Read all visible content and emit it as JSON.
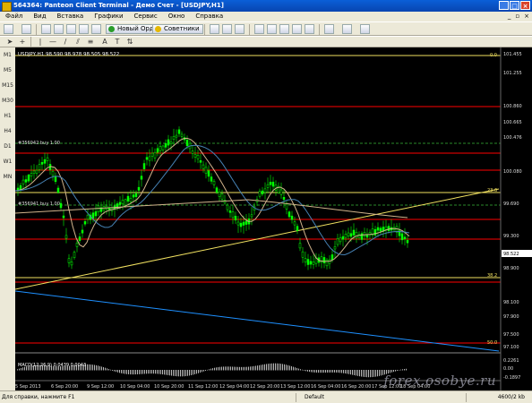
{
  "window": {
    "title": "564364: Panteon Client Terminal - Демо Счет - [USDJPY,H1]"
  },
  "menu": {
    "items": [
      "Файл",
      "Вид",
      "Вставка",
      "Графики",
      "Сервис",
      "Окно",
      "Справка"
    ]
  },
  "toolbar": {
    "new_order_label": "Новый Ордер",
    "advisors_label": "Советники"
  },
  "periods": [
    "M1",
    "M5",
    "M15",
    "M30",
    "H1",
    "H4",
    "D1",
    "W1",
    "MN"
  ],
  "chart": {
    "symbol_label": "USDJPY,H1  98.590 98.978 98.505 98.522",
    "order_labels": [
      "#356942 buy 1.00",
      "#356941 buy 1.00"
    ],
    "price_axis": [
      "101.455",
      "101.255",
      "100.860",
      "100.665",
      "100.476",
      "100.080",
      "99.690",
      "99.300",
      "98.900",
      "98.522",
      "98.100",
      "97.900",
      "97.500",
      "97.100"
    ],
    "level_tags": {
      "top": "0.0",
      "mid": "23.6",
      "low": "38.2",
      "bottom": "50.0"
    },
    "time_axis": [
      "5 Sep 2013",
      "6 Sep 20:00",
      "9 Sep 12:00",
      "10 Sep 04:00",
      "10 Sep 20:00",
      "11 Sep 12:00",
      "12 Sep 04:00",
      "12 Sep 20:00",
      "13 Sep 12:00",
      "16 Sep 04:00",
      "16 Sep 20:00",
      "17 Sep 12:00",
      "18 Sep 04:00"
    ],
    "macd_label": "MACD(12,26,9)  0.0439 0.0043",
    "macd_axis": [
      "0.2261",
      "0.00",
      "-0.1897"
    ],
    "watermark": "forex.osobye.ru",
    "colors": {
      "bull": "#00ff00",
      "bear": "#00ff00",
      "red_line": "#ff0000",
      "trend": "#f0e060",
      "blue": "#1e90ff"
    }
  },
  "status": {
    "help": "Для справки, нажмите F1",
    "mid": "Default",
    "traffic": "4600/2 kb"
  }
}
